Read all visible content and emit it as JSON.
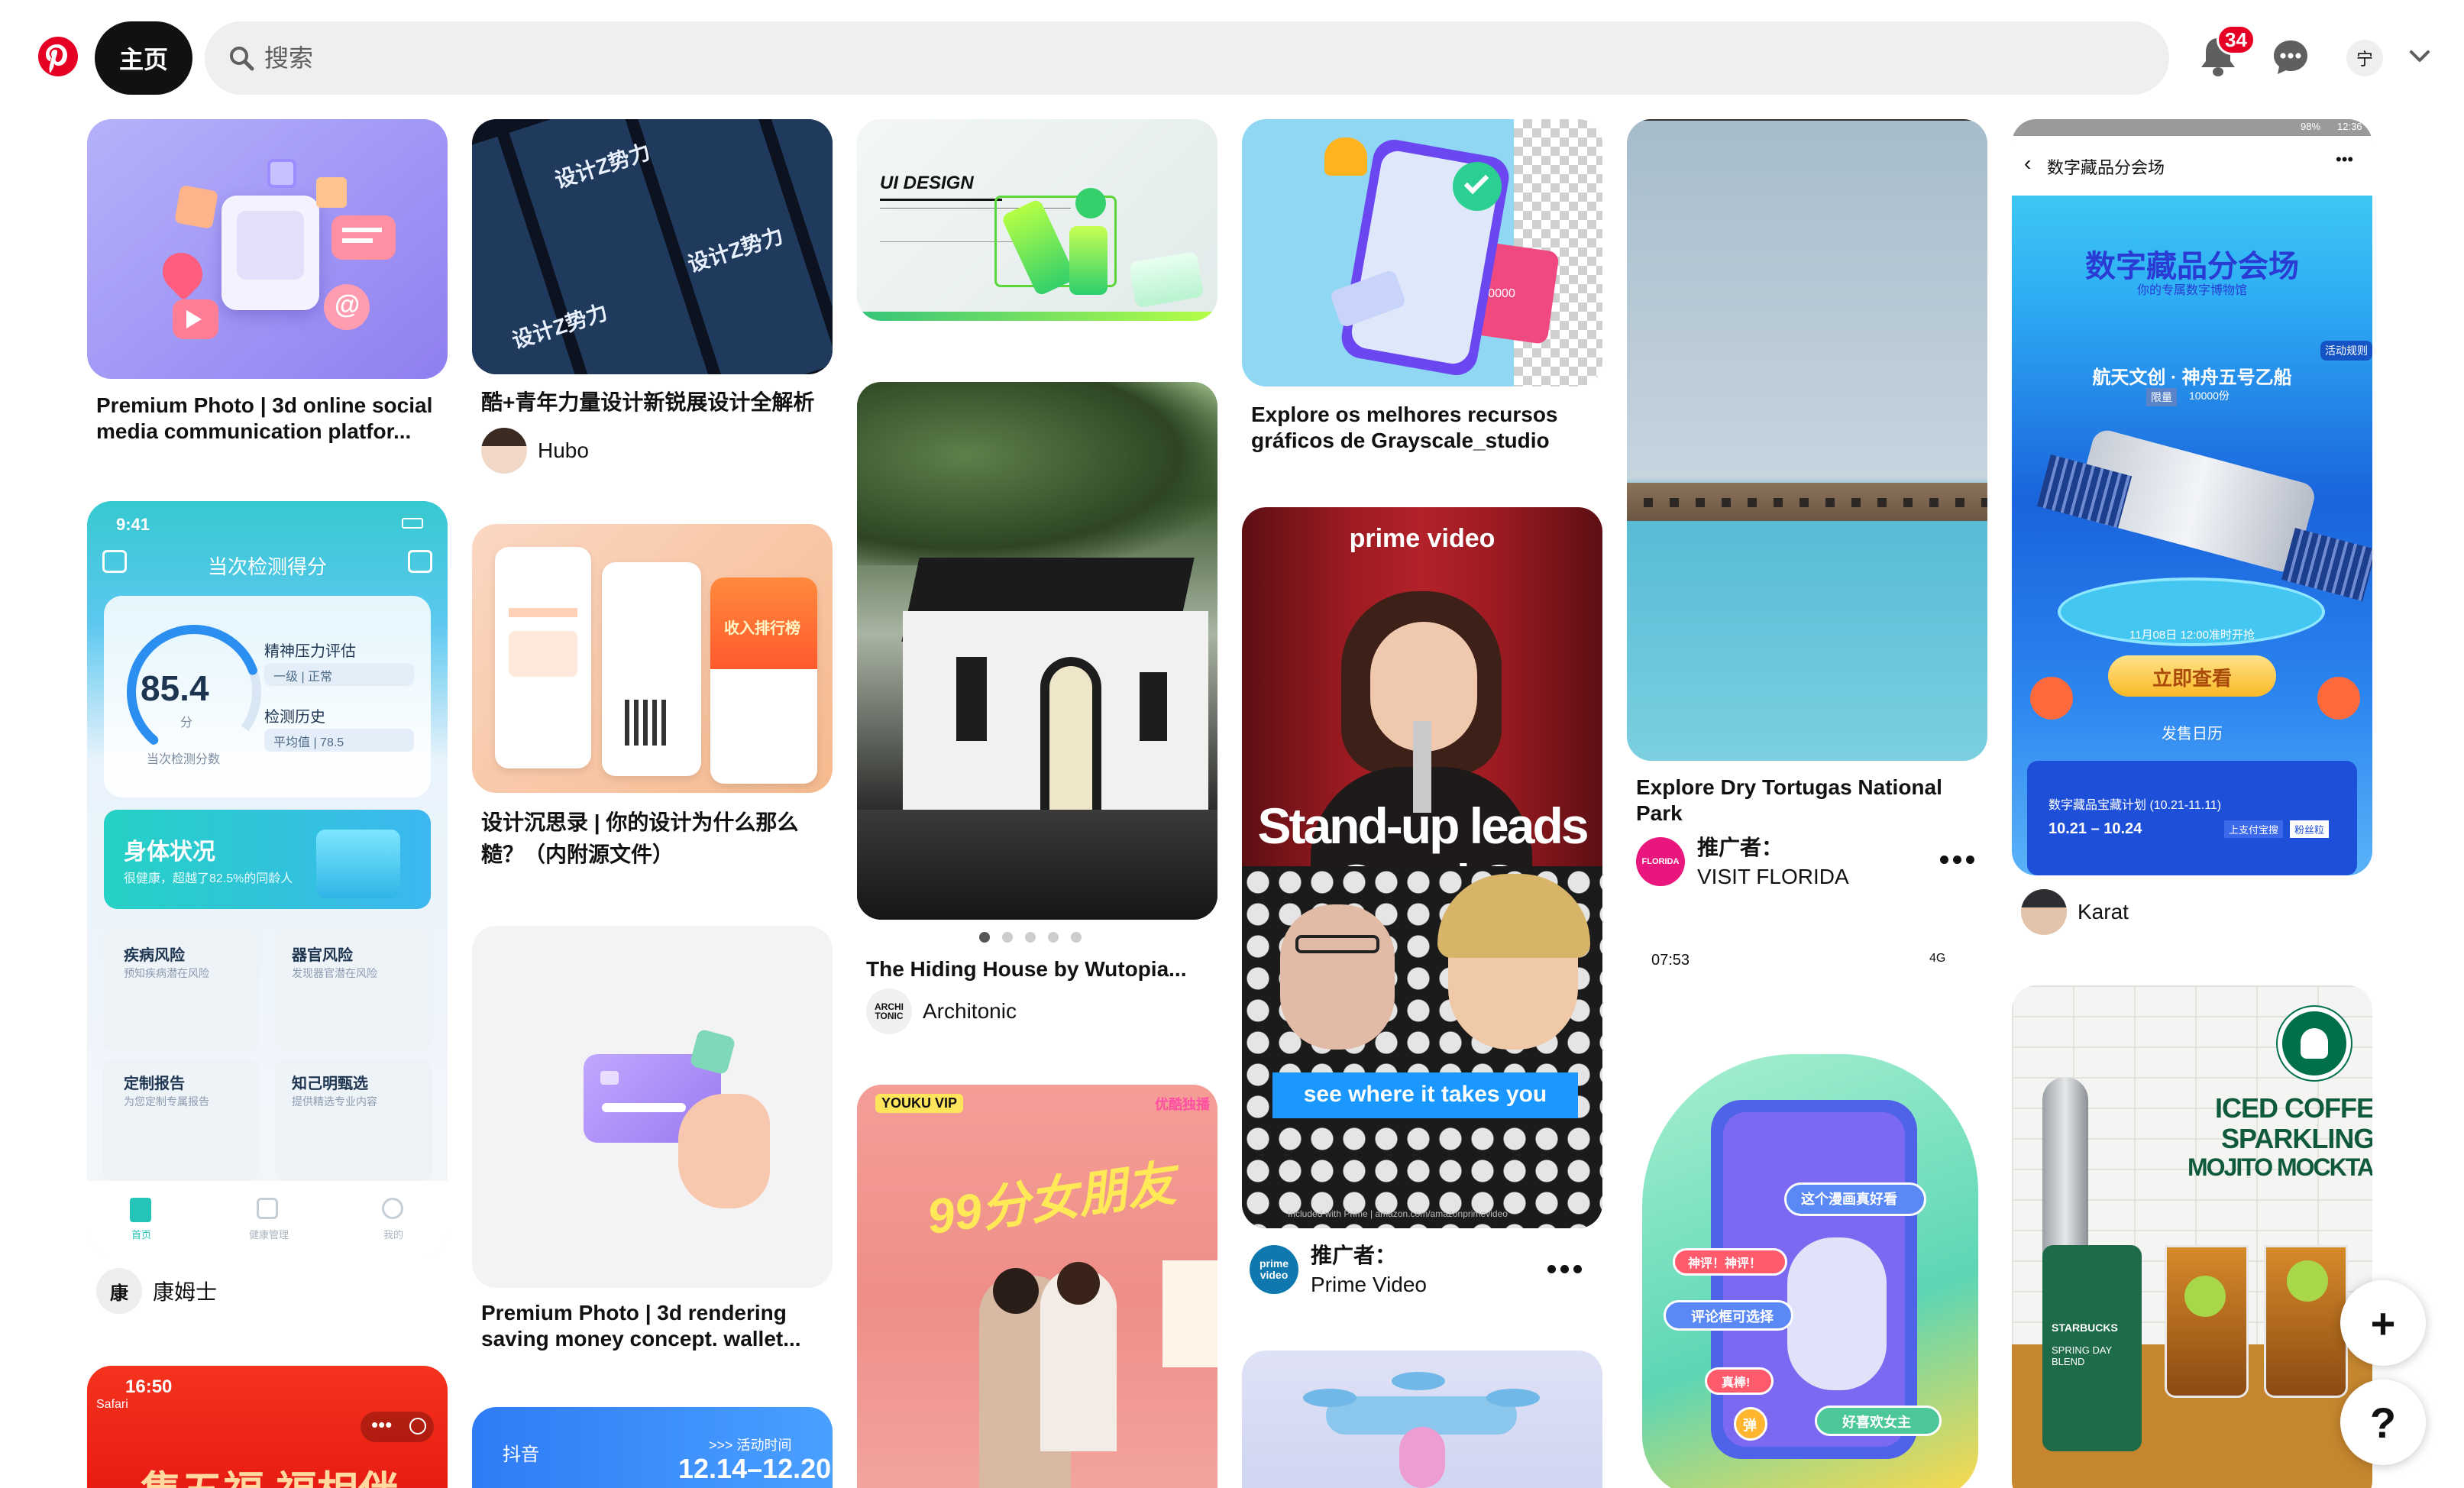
{
  "header": {
    "home_label": "主页",
    "search_placeholder": "搜索",
    "notification_count": "34",
    "user_initial": "宁"
  },
  "pins": {
    "social_media": {
      "title": "Premium Photo | 3d online social media communication platfor..."
    },
    "youth_design": {
      "title": "酷+青年力量设计新锐展设计全解析",
      "author": "Hubo",
      "banner": "设计Z势力"
    },
    "ui_design": {
      "heading": "UI DESIGN"
    },
    "grayscale": {
      "title": "Explore os melhores recursos gráficos de Grayscale_studio",
      "card_text": "00 0000"
    },
    "tortugas": {
      "title": "Explore Dry Tortugas National Park",
      "promoted_label": "推广者：",
      "advertiser": "VISIT FLORIDA",
      "avatar_text": "FLORIDA"
    },
    "digital_collection": {
      "author": "Karat",
      "status_time": "12:36",
      "status_battery": "98%",
      "nav_title": "数字藏品分会场",
      "hero_title": "数字藏品分会场",
      "hero_sub": "你的专属数字博物馆",
      "rule": "活动规则",
      "product": "航天文创 · 神舟五号乙船",
      "limit": "限量",
      "limit_count": "10000份",
      "sale_date": "11月08日 12:00准时开抢",
      "cta": "立即查看",
      "calendar": "发售日历",
      "plan": "数字藏品宝藏计划 (10.21-11.11)",
      "range": "10.21 – 10.24",
      "link1": "上支付宝搜",
      "link2": "粉丝粒"
    },
    "health_app": {
      "author": "康姆士",
      "author_initial": "康",
      "time": "9:41",
      "header_title": "当次检测得分",
      "score": "85.4",
      "score_unit": "分",
      "score_caption": "当次检测分数",
      "stress_label": "精神压力评估",
      "stress_value": "一级 | 正常",
      "history_label": "检测历史",
      "history_value": "平均值 | 78.5",
      "body_title": "身体状况",
      "body_sub": "很健康，超越了82.5%的同龄人",
      "tiles": [
        {
          "t": "疾病风险",
          "s": "预知疾病潜在风险"
        },
        {
          "t": "器官风险",
          "s": "发现器官潜在风险"
        },
        {
          "t": "定制报告",
          "s": "为您定制专属报告"
        },
        {
          "t": "知己明甄选",
          "s": "提供精选专业内容"
        }
      ],
      "tabs": [
        "首页",
        "健康管理",
        "我的"
      ]
    },
    "design_notes": {
      "title": "设计沉思录 | 你的设计为什么那么糙？（内附源文件）",
      "ranking": "收入排行榜"
    },
    "hiding_house": {
      "title": "The Hiding House by Wutopia...",
      "author": "Architonic",
      "author_logo": "ARCHI TONIC"
    },
    "prime_video": {
      "brand": "prime video",
      "headline": "Stand-up leads to Stand Out",
      "cta": "see where it takes you",
      "fine_print": "Included with Prime | amazon.com/amazonprimevideo",
      "promoted_label": "推广者：",
      "advertiser": "Prime Video",
      "avatar_text": "prime video"
    },
    "wallet": {
      "title": "Premium Photo | 3d rendering saving money concept. wallet..."
    },
    "comic_app": {
      "time": "07:53",
      "signal": "4G",
      "bubbles": [
        "这个漫画真好看",
        "神评！神评！",
        "评论框可选择",
        "真棒!",
        "好喜欢女主",
        "弹"
      ]
    },
    "youku": {
      "brand": "YOUKU VIP",
      "title_art": "99分女朋友",
      "tag": "优酷独播"
    },
    "starbucks": {
      "line1": "ICED COFFEE",
      "line2": "SPARKLING",
      "line3": "MOJITO MOCKTAIL",
      "bag1": "STARBUCKS",
      "bag2": "SPRING DAY BLEND"
    },
    "fu": {
      "time": "16:50",
      "back": "Safari",
      "banner": "集五福 福相伴"
    },
    "douyin": {
      "app": "抖音",
      "event": ">>> 活动时间",
      "dates": "12.14–12.20"
    }
  },
  "fab": {
    "add": "+",
    "help": "?"
  },
  "colors": {
    "brand": "#e60023",
    "search_bg": "#efefef",
    "text": "#111111"
  }
}
